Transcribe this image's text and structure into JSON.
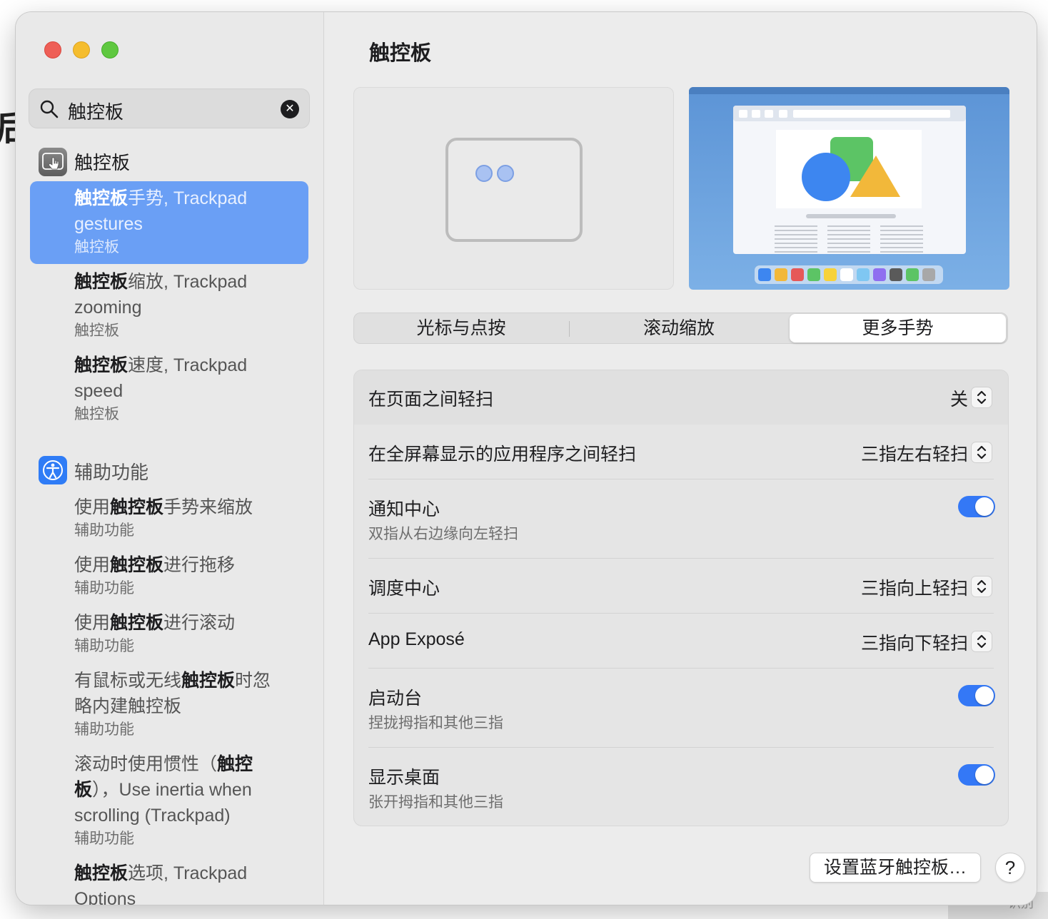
{
  "background": {
    "left_text": "后",
    "strip_text": "识别"
  },
  "search": {
    "value": "触控板"
  },
  "sidebar": {
    "sections": [
      {
        "title": "触控板",
        "icon": "trackpad-hand-icon"
      },
      {
        "title": "辅助功能",
        "icon": "accessibility-icon"
      }
    ],
    "results": [
      {
        "bold": "触控板",
        "rest": "手势, Trackpad",
        "line2": "gestures",
        "sub": "触控板",
        "selected": true
      },
      {
        "bold": "触控板",
        "rest": "缩放, Trackpad",
        "line2": "zooming",
        "sub": "触控板"
      },
      {
        "bold": "触控板",
        "rest": "速度, Trackpad",
        "line2": "speed",
        "sub": "触控板"
      },
      {
        "pre": "使用",
        "bold": "触控板",
        "rest": "手势来缩放",
        "sub": "辅助功能"
      },
      {
        "pre": "使用",
        "bold": "触控板",
        "rest": "进行拖移",
        "sub": "辅助功能"
      },
      {
        "pre": "使用",
        "bold": "触控板",
        "rest": "进行滚动",
        "sub": "辅助功能"
      },
      {
        "pre": "有鼠标或无线",
        "bold": "触控板",
        "rest": "时忽",
        "line2": "略内建触控板",
        "sub": "辅助功能"
      },
      {
        "pre": "滚动时使用惯性（",
        "bold": "触控",
        "line2_bold": "板",
        "line2": "），Use inertia when",
        "line3": "scrolling (Trackpad)",
        "sub": "辅助功能"
      },
      {
        "bold": "触控板",
        "rest": "选项, Trackpad",
        "line2": "Options"
      }
    ]
  },
  "main": {
    "title": "触控板",
    "tabs": [
      "光标与点按",
      "滚动缩放",
      "更多手势"
    ],
    "active_tab": "更多手势",
    "rows": [
      {
        "label": "在页面之间轻扫",
        "value": "关",
        "control": "stepper"
      },
      {
        "label": "在全屏幕显示的应用程序之间轻扫",
        "value": "三指左右轻扫",
        "control": "stepper"
      },
      {
        "label": "通知中心",
        "sub": "双指从右边缘向左轻扫",
        "control": "toggle",
        "on": true
      },
      {
        "label": "调度中心",
        "value": "三指向上轻扫",
        "control": "stepper"
      },
      {
        "label": "App Exposé",
        "value": "三指向下轻扫",
        "control": "stepper"
      },
      {
        "label": "启动台",
        "sub": "捏拢拇指和其他三指",
        "control": "toggle",
        "on": true
      },
      {
        "label": "显示桌面",
        "sub": "张开拇指和其他三指",
        "control": "toggle",
        "on": true
      }
    ],
    "bluetooth_button": "设置蓝牙触控板…",
    "help_button": "?"
  },
  "colors": {
    "accent": "#3478f6",
    "selection": "#6a9ff5"
  }
}
